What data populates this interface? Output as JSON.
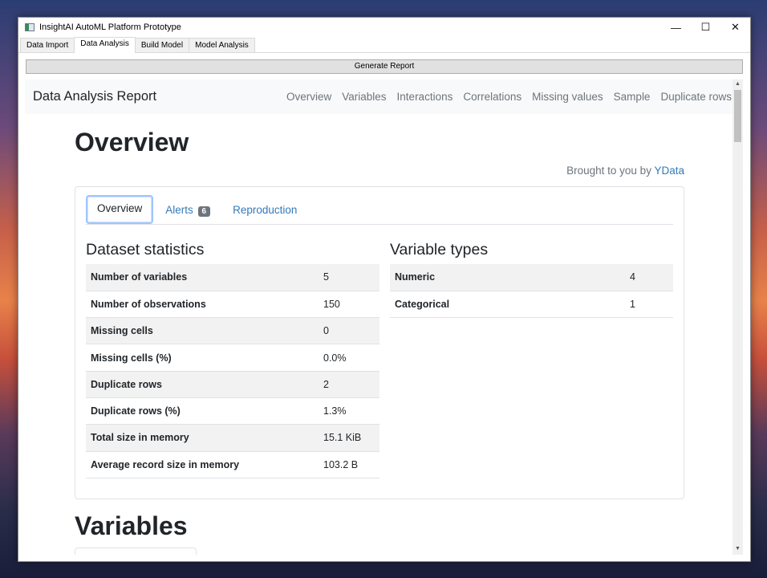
{
  "window": {
    "title": "InsightAI AutoML Platform Prototype",
    "controls": {
      "minimize": "—",
      "maximize": "☐",
      "close": "✕"
    }
  },
  "tabs": [
    "Data Import",
    "Data Analysis",
    "Build Model",
    "Model Analysis"
  ],
  "active_tab": "Data Analysis",
  "generate_report_label": "Generate Report",
  "report": {
    "brand": "Data Analysis Report",
    "nav": [
      "Overview",
      "Variables",
      "Interactions",
      "Correlations",
      "Missing values",
      "Sample",
      "Duplicate rows"
    ],
    "overview_heading": "Overview",
    "brought_prefix": "Brought to you by",
    "brought_link": "YData",
    "pills": {
      "overview": "Overview",
      "alerts": "Alerts",
      "alerts_count": "6",
      "reproduction": "Reproduction"
    },
    "dataset_statistics": {
      "heading": "Dataset statistics",
      "rows": [
        {
          "label": "Number of variables",
          "value": "5"
        },
        {
          "label": "Number of observations",
          "value": "150"
        },
        {
          "label": "Missing cells",
          "value": "0"
        },
        {
          "label": "Missing cells (%)",
          "value": "0.0%"
        },
        {
          "label": "Duplicate rows",
          "value": "2"
        },
        {
          "label": "Duplicate rows (%)",
          "value": "1.3%"
        },
        {
          "label": "Total size in memory",
          "value": "15.1 KiB"
        },
        {
          "label": "Average record size in memory",
          "value": "103.2 B"
        }
      ]
    },
    "variable_types": {
      "heading": "Variable types",
      "rows": [
        {
          "label": "Numeric",
          "value": "4"
        },
        {
          "label": "Categorical",
          "value": "1"
        }
      ]
    },
    "variables_heading": "Variables"
  },
  "colors": {
    "link": "#337ab7",
    "muted": "#6c757d",
    "badge": "#6c757d"
  },
  "scrollbar": {
    "arrow_up": "▲",
    "arrow_down": "▼"
  }
}
